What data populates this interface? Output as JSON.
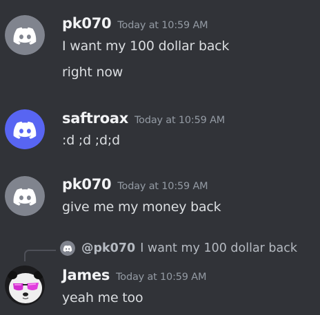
{
  "messages": [
    {
      "author": "pk070",
      "timestamp": "Today at 10:59 AM",
      "avatar_icon": "discord-logo-icon",
      "avatar_color": "#80848e",
      "lines": [
        "I want my 100 dollar back",
        "right now"
      ]
    },
    {
      "author": "saftroax",
      "timestamp": "Today at 10:59 AM",
      "avatar_icon": "discord-logo-icon",
      "avatar_color": "#5865f2",
      "lines": [
        ":d ;d ;d;d"
      ]
    },
    {
      "author": "pk070",
      "timestamp": "Today at 10:59 AM",
      "avatar_icon": "discord-logo-icon",
      "avatar_color": "#80848e",
      "lines": [
        "give me my money back"
      ]
    },
    {
      "author": "James",
      "timestamp": "Today at 10:59 AM",
      "avatar_icon": "panda-sunglasses-avatar-icon",
      "reply": {
        "mention": "@pk070",
        "text": "I want my 100 dollar back"
      },
      "lines": [
        "yeah me too"
      ]
    }
  ]
}
